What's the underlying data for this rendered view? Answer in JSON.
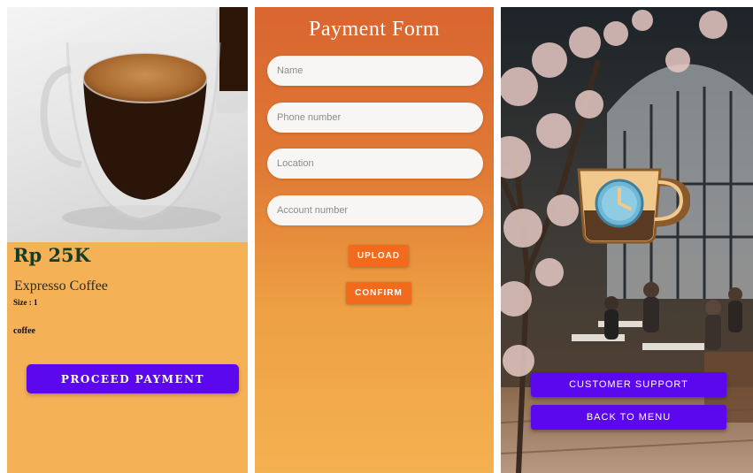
{
  "product_screen": {
    "price": "Rp 25K",
    "name": "Expresso Coffee",
    "size": "Size : 1",
    "category": "coffee",
    "proceed_label": "PROCEED PAYMENT",
    "button_color": "#5c08ee",
    "background_color": "#f5b155"
  },
  "payment_form": {
    "title": "Payment Form",
    "fields": {
      "name_placeholder": "Name",
      "phone_placeholder": "Phone number",
      "location_placeholder": "Location",
      "account_placeholder": "Account number"
    },
    "upload_label": "UPLOAD",
    "confirm_label": "CONFIRM",
    "button_color": "#f26a1c"
  },
  "menu_screen": {
    "logo_icon": "coffee-cup-clock-icon",
    "customer_support_label": "CUSTOMER SUPPORT",
    "back_to_menu_label": "BACK TO MENU",
    "button_color": "#5c08ee"
  }
}
